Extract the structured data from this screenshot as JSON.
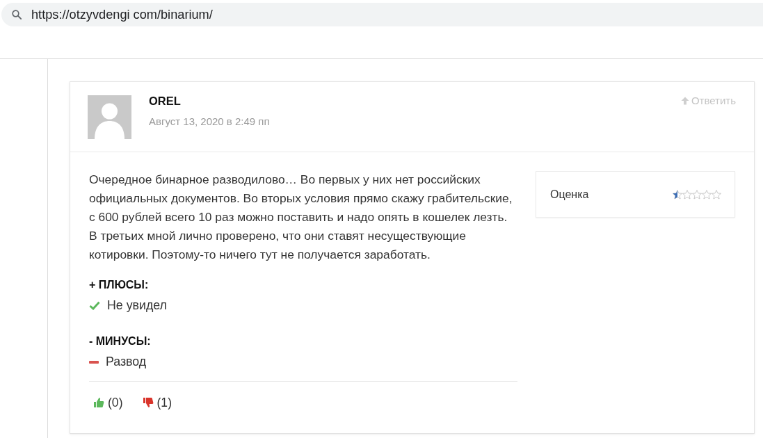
{
  "address_bar": {
    "url": "https://otzyvdengi com/binarium/"
  },
  "comment": {
    "author": "OREL",
    "date": "Август 13, 2020 в 2:49 пп",
    "reply_label": "Ответить",
    "text": "Очередное бинарное разводилово… Во первых у них нет российских официальных документов. Во вторых условия прямо скажу грабительские, с 600 рублей всего 10 раз можно поставить и надо опять в кошелек лезть. В третьих мной лично проверено, что они ставят несуществующие котировки. Поэтому-то ничего тут не получается заработать.",
    "rating": {
      "label": "Оценка",
      "stars": 0.5
    },
    "pros": {
      "heading": "+ ПЛЮСЫ:",
      "items": [
        "Не увидел"
      ]
    },
    "cons": {
      "heading": "- МИНУСЫ:",
      "items": [
        "Развод"
      ]
    },
    "votes": {
      "likes": "(0)",
      "dislikes": "(1)"
    }
  }
}
